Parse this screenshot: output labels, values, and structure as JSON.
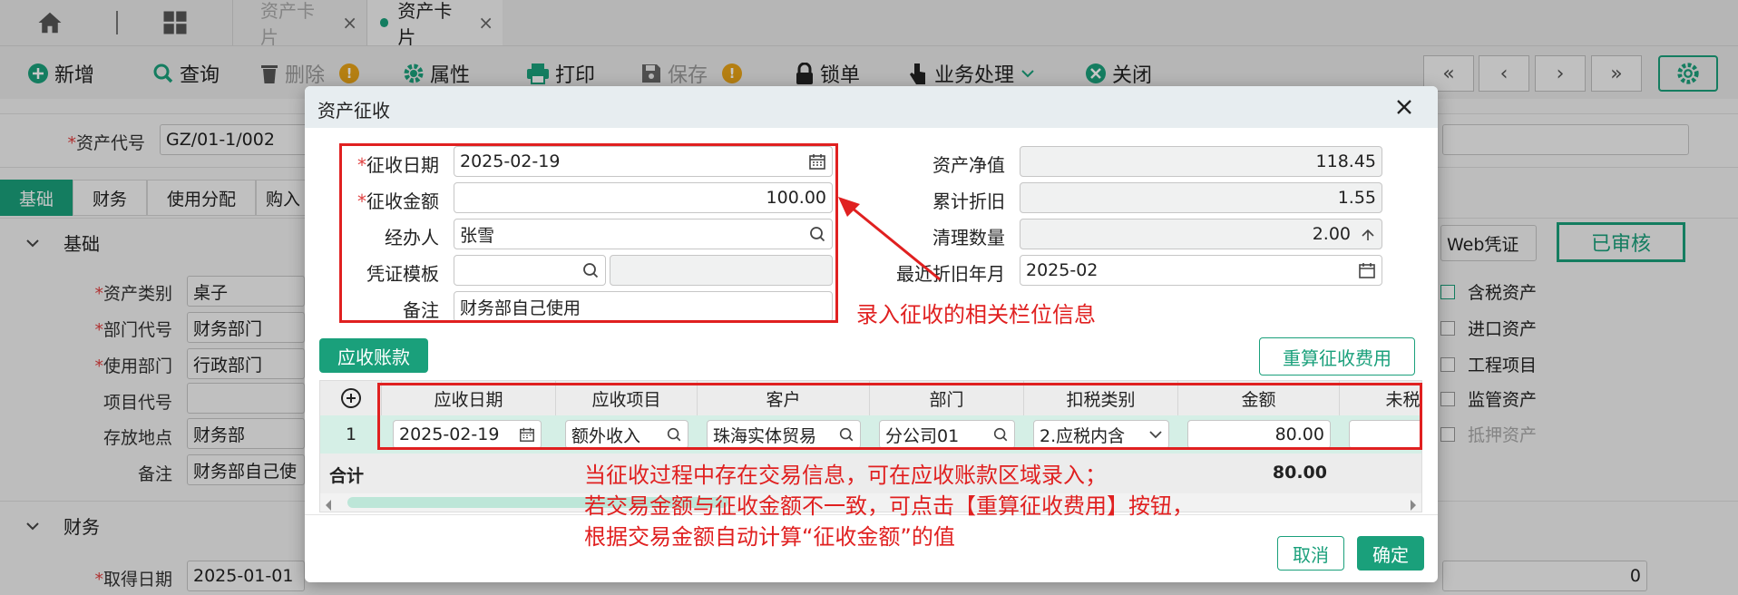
{
  "tabbar": {
    "tabs": [
      {
        "label": "资产卡片",
        "active": false
      },
      {
        "label": "资产卡片",
        "active": true
      }
    ],
    "close_glyph": "×"
  },
  "toolbar": {
    "add": "新增",
    "query": "查询",
    "delete": "删除",
    "properties": "属性",
    "print": "打印",
    "save": "保存",
    "lock": "锁单",
    "business": "业务处理",
    "close": "关闭",
    "warn_glyph": "!",
    "nav": [
      "«",
      "‹",
      "›",
      "»"
    ]
  },
  "background": {
    "asset_code_label": "资产代号",
    "asset_code_value": "GZ/01-1/002",
    "subtabs": [
      "基础",
      "财务",
      "使用分配",
      "购入"
    ],
    "section_basic": "基础",
    "section_finance": "财务",
    "fields": [
      {
        "label": "资产类别",
        "value": "桌子",
        "required": true
      },
      {
        "label": "部门代号",
        "value": "财务部门",
        "required": true
      },
      {
        "label": "使用部门",
        "value": "行政部门",
        "required": true
      },
      {
        "label": "项目代号",
        "value": "",
        "required": false
      },
      {
        "label": "存放地点",
        "value": "财务部",
        "required": false
      },
      {
        "label": "备注",
        "value": "财务部自己使",
        "required": false
      }
    ],
    "acq_date_label": "取得日期",
    "acq_date_value": "2025-01-01",
    "right_value_zero": "0",
    "web_voucher": "Web凭证",
    "audited": "已审核",
    "checks": [
      {
        "label": "含税资产",
        "checked": true
      },
      {
        "label": "进口资产",
        "checked": false
      },
      {
        "label": "工程项目",
        "checked": false
      },
      {
        "label": "监管资产",
        "checked": false
      },
      {
        "label": "抵押资产",
        "checked": false
      }
    ],
    "required_mark": "*"
  },
  "modal": {
    "title": "资产征收",
    "left_fields": {
      "collect_date_label": "征收日期",
      "collect_date_value": "2025-02-19",
      "collect_amount_label": "征收金额",
      "collect_amount_value": "100.00",
      "handler_label": "经办人",
      "handler_value": "张雪",
      "voucher_tpl_label": "凭证模板",
      "voucher_tpl_value": "",
      "remark_label": "备注",
      "remark_value": "财务部自己使用"
    },
    "right_fields": {
      "net_value_label": "资产净值",
      "net_value_value": "118.45",
      "acc_depr_label": "累计折旧",
      "acc_depr_value": "1.55",
      "clear_qty_label": "清理数量",
      "clear_qty_value": "2.00",
      "last_depr_label": "最近折旧年月",
      "last_depr_value": "2025-02"
    },
    "ar_button": "应收账款",
    "recalc_button": "重算征收费用",
    "grid": {
      "headers": [
        "应收日期",
        "应收项目",
        "客户",
        "部门",
        "扣税类别",
        "金额",
        "未税"
      ],
      "row": {
        "index": "1",
        "date": "2025-02-19",
        "item": "额外收入",
        "customer": "珠海实体贸易",
        "dept": "分公司01",
        "tax_type": "2.应税内含",
        "amount": "80.00"
      },
      "total_label": "合计",
      "total_amount": "80.00"
    },
    "cancel_button": "取消",
    "ok_button": "确定"
  },
  "annotations": {
    "top_note": "录入征收的相关栏位信息",
    "grid_note_lines": [
      "当征收过程中存在交易信息，可在应收账款区域录入；",
      "若交易金额与征收金额不一致，可点击【重算征收费用】按钮，",
      "根据交易金额自动计算“征收金额”的值"
    ]
  },
  "colors": {
    "accent": "#1aa07b",
    "annotation": "#e02020"
  }
}
